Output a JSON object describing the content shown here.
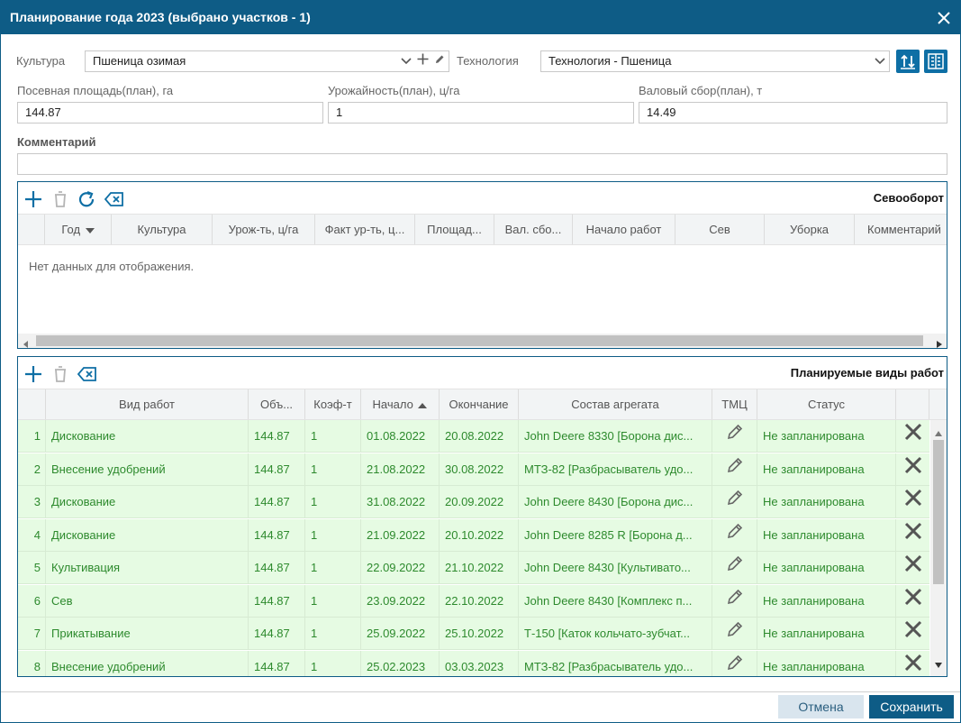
{
  "dialog": {
    "title": "Планирование года 2023 (выбрано участков - 1)"
  },
  "form": {
    "culture_label": "Культура",
    "culture_value": "Пшеница озимая",
    "technology_label": "Технология",
    "technology_value": "Технология - Пшеница",
    "area_label": "Посевная площадь(план), га",
    "area_value": "144.87",
    "yield_label": "Урожайность(план), ц/га",
    "yield_value": "1",
    "gross_label": "Валовый сбор(план), т",
    "gross_value": "14.49",
    "comment_label": "Комментарий",
    "comment_value": ""
  },
  "rotation": {
    "title": "Севооборот",
    "columns": [
      "Год",
      "Культура",
      "Урож-ть, ц/га",
      "Факт ур-ть, ц...",
      "Площад...",
      "Вал. сбо...",
      "Начало работ",
      "Сев",
      "Уборка",
      "Комментарий"
    ],
    "empty_text": "Нет данных для отображения."
  },
  "works": {
    "title": "Планируемые виды работ",
    "columns": [
      "Вид работ",
      "Объ...",
      "Коэф-т",
      "Начало",
      "Окончание",
      "Состав агрегата",
      "ТМЦ",
      "Статус"
    ],
    "rows": [
      {
        "n": "1",
        "type": "Дискование",
        "vol": "144.87",
        "coef": "1",
        "start": "01.08.2022",
        "end": "20.08.2022",
        "unit": "John Deere 8330 [Борона дис...",
        "status": "Не запланирована"
      },
      {
        "n": "2",
        "type": "Внесение удобрений",
        "vol": "144.87",
        "coef": "1",
        "start": "21.08.2022",
        "end": "30.08.2022",
        "unit": "МТЗ-82 [Разбрасыватель удо...",
        "status": "Не запланирована"
      },
      {
        "n": "3",
        "type": "Дискование",
        "vol": "144.87",
        "coef": "1",
        "start": "31.08.2022",
        "end": "20.09.2022",
        "unit": "John Deere 8430 [Борона дис...",
        "status": "Не запланирована"
      },
      {
        "n": "4",
        "type": "Дискование",
        "vol": "144.87",
        "coef": "1",
        "start": "21.09.2022",
        "end": "20.10.2022",
        "unit": "John Deere 8285 R [Борона д...",
        "status": "Не запланирована"
      },
      {
        "n": "5",
        "type": "Культивация",
        "vol": "144.87",
        "coef": "1",
        "start": "22.09.2022",
        "end": "21.10.2022",
        "unit": "John Deere 8430 [Культивато...",
        "status": "Не запланирована"
      },
      {
        "n": "6",
        "type": "Сев",
        "vol": "144.87",
        "coef": "1",
        "start": "23.09.2022",
        "end": "22.10.2022",
        "unit": "John Deere 8430 [Комплекс п...",
        "status": "Не запланирована"
      },
      {
        "n": "7",
        "type": "Прикатывание",
        "vol": "144.87",
        "coef": "1",
        "start": "25.09.2022",
        "end": "25.10.2022",
        "unit": "Т-150 [Каток кольчато-зубчат...",
        "status": "Не запланирована"
      },
      {
        "n": "8",
        "type": "Внесение удобрений",
        "vol": "144.87",
        "coef": "1",
        "start": "25.02.2023",
        "end": "03.03.2023",
        "unit": "МТЗ-82 [Разбрасыватель удо...",
        "status": "Не запланирована"
      }
    ]
  },
  "footer": {
    "cancel_label": "Отмена",
    "save_label": "Сохранить"
  },
  "colors": {
    "brand": "#0e5c86",
    "row_bg": "#e6fbe3",
    "row_text": "#2d8a2d"
  },
  "icons": [
    "close-icon",
    "dropdown-arrow-icon",
    "plus-icon",
    "pencil-icon",
    "sort-icon",
    "columns-icon",
    "delete-icon",
    "refresh-icon",
    "clear-icon",
    "x-icon"
  ]
}
